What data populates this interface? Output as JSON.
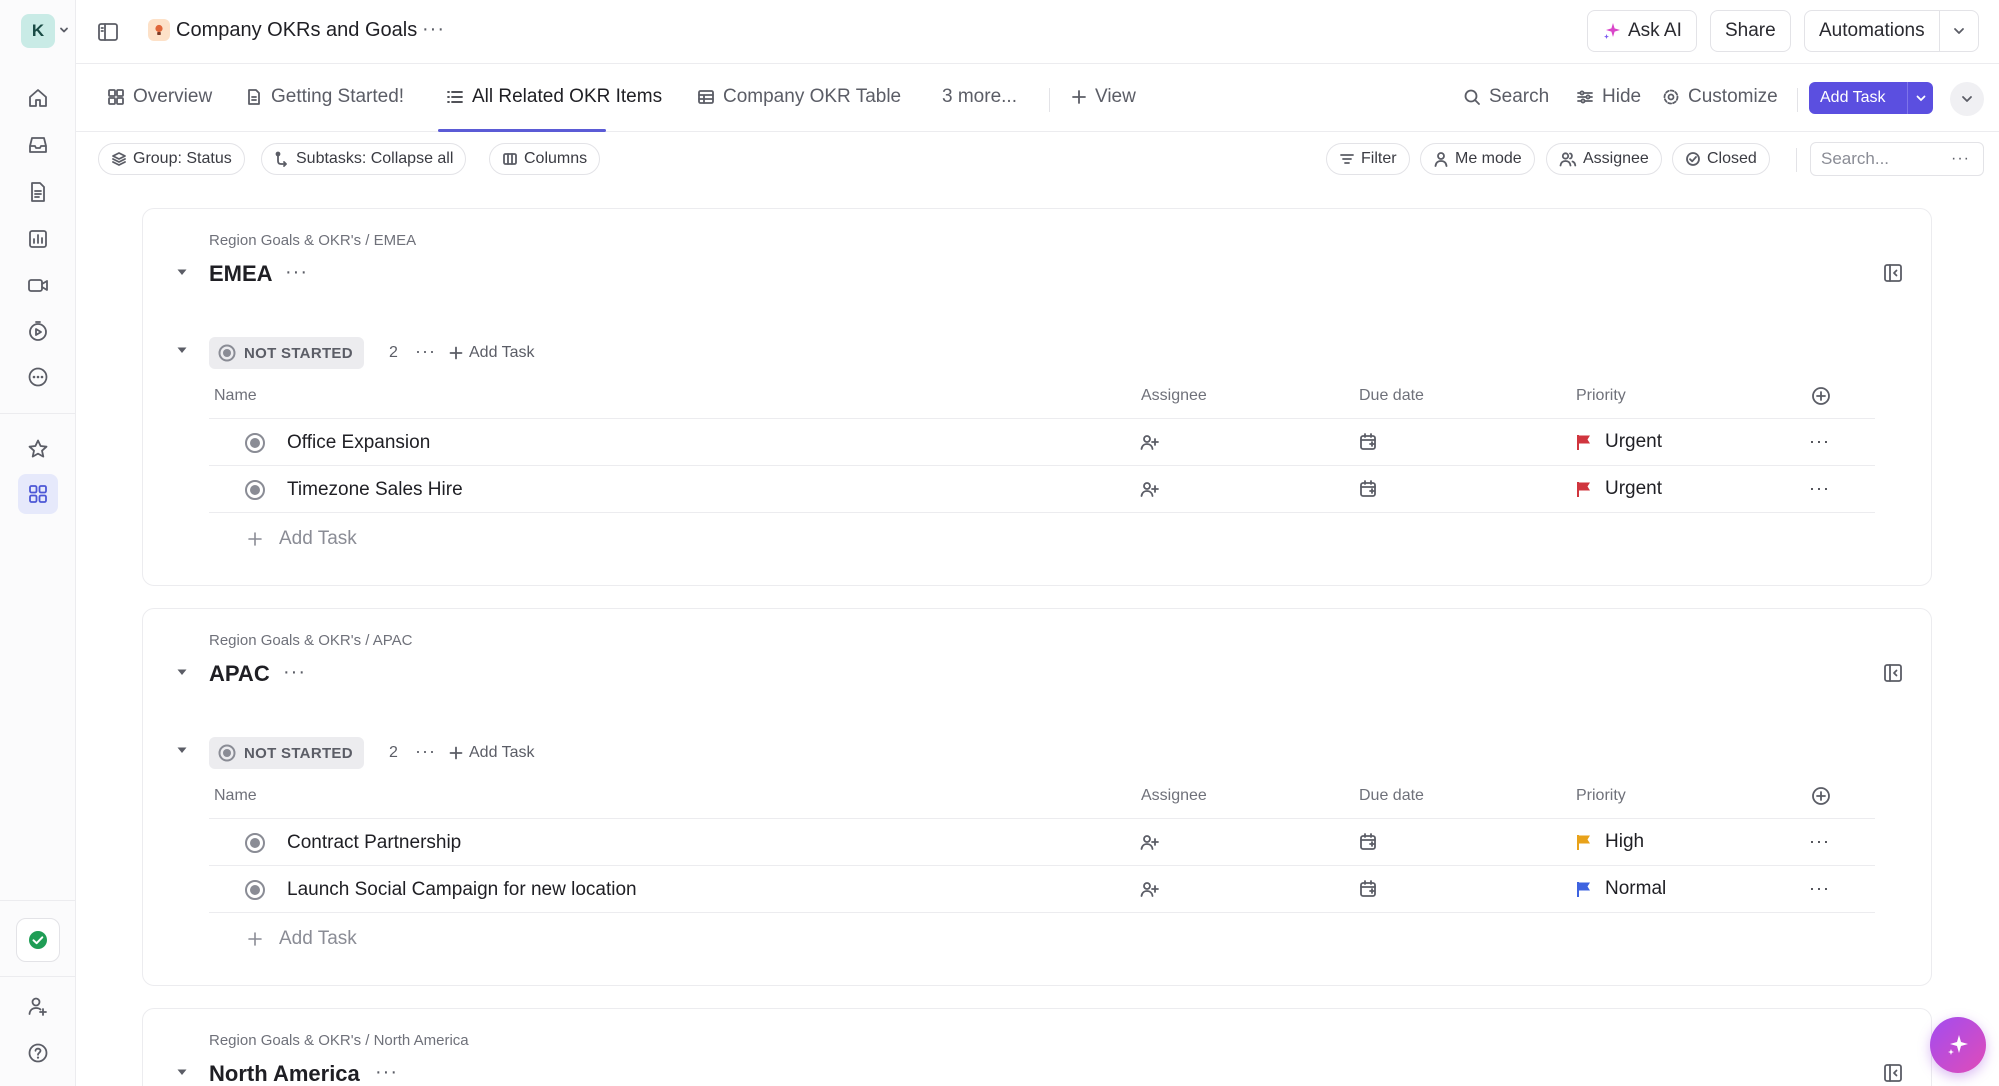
{
  "workspace": {
    "initial": "K"
  },
  "topbar": {
    "title": "Company OKRs and Goals",
    "more": "···",
    "ask_ai": "Ask AI",
    "share": "Share",
    "automations": "Automations"
  },
  "views": {
    "tabs": [
      {
        "label": "Overview",
        "icon": "overview-icon",
        "active": false
      },
      {
        "label": "Getting Started!",
        "icon": "doc-icon",
        "active": false
      },
      {
        "label": "All Related OKR Items",
        "icon": "list-icon",
        "active": true
      },
      {
        "label": "Company OKR Table",
        "icon": "table-icon",
        "active": false
      },
      {
        "label": "3 more...",
        "icon": "",
        "active": false
      }
    ],
    "add_view": "View",
    "search": "Search",
    "hide": "Hide",
    "customize": "Customize",
    "add_task": "Add Task"
  },
  "filters": {
    "group": "Group: Status",
    "subtasks": "Subtasks: Collapse all",
    "columns": "Columns",
    "filter": "Filter",
    "me_mode": "Me mode",
    "assignee": "Assignee",
    "closed": "Closed",
    "search_placeholder": "Search...",
    "more": "···"
  },
  "columns": {
    "name": "Name",
    "assignee": "Assignee",
    "due_date": "Due date",
    "priority": "Priority"
  },
  "groups": [
    {
      "breadcrumb": "Region Goals & OKR's / EMEA",
      "title": "EMEA",
      "more": "···",
      "status": {
        "label": "NOT STARTED",
        "count": "2",
        "more": "···",
        "add_task": "Add Task"
      },
      "tasks": [
        {
          "name": "Office Expansion",
          "priority": "Urgent",
          "priority_color": "#d0353e",
          "more": "···"
        },
        {
          "name": "Timezone Sales Hire",
          "priority": "Urgent",
          "priority_color": "#d0353e",
          "more": "···"
        }
      ],
      "add_task": "Add Task"
    },
    {
      "breadcrumb": "Region Goals & OKR's / APAC",
      "title": "APAC",
      "more": "···",
      "status": {
        "label": "NOT STARTED",
        "count": "2",
        "more": "···",
        "add_task": "Add Task"
      },
      "tasks": [
        {
          "name": "Contract Partnership",
          "priority": "High",
          "priority_color": "#e8a21a",
          "more": "···"
        },
        {
          "name": "Launch Social Campaign for new location",
          "priority": "Normal",
          "priority_color": "#3e63e0",
          "more": "···"
        }
      ],
      "add_task": "Add Task"
    },
    {
      "breadcrumb": "Region Goals & OKR's / North America",
      "title": "North America",
      "more": "···"
    }
  ],
  "colors": {
    "accent": "#5b4fe0",
    "urgent": "#d0353e",
    "high": "#e8a21a",
    "normal": "#3e63e0",
    "success": "#1f9d55"
  }
}
